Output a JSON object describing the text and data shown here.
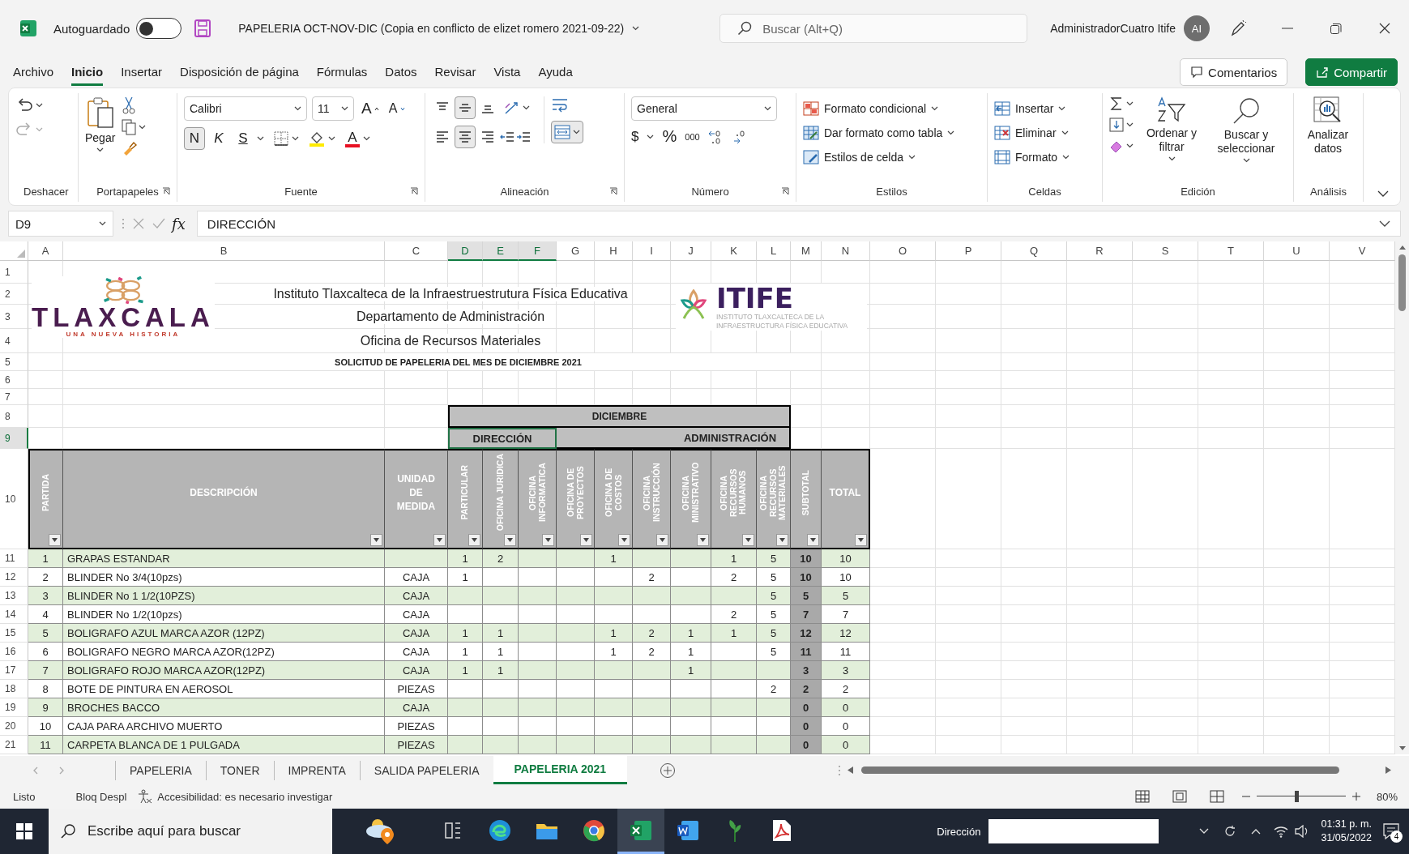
{
  "window": {
    "autosave_label": "Autoguardado",
    "autosave_on": false,
    "title": "PAPELERIA OCT-NOV-DIC (Copia en conflicto de elizet romero 2021-09-22)",
    "search_placeholder": "Buscar (Alt+Q)",
    "user_name": "AdministradorCuatro Itife",
    "user_initials": "AI"
  },
  "ribbon_tabs": [
    {
      "label": "Archivo",
      "selected": false
    },
    {
      "label": "Inicio",
      "selected": true
    },
    {
      "label": "Insertar",
      "selected": false
    },
    {
      "label": "Disposición de página",
      "selected": false
    },
    {
      "label": "Fórmulas",
      "selected": false
    },
    {
      "label": "Datos",
      "selected": false
    },
    {
      "label": "Revisar",
      "selected": false
    },
    {
      "label": "Vista",
      "selected": false
    },
    {
      "label": "Ayuda",
      "selected": false
    }
  ],
  "ribbon_actions": [
    {
      "label": "Comentarios",
      "kind": "comments"
    },
    {
      "label": "Compartir",
      "kind": "share"
    }
  ],
  "ribbon": {
    "undo": {
      "label": "Deshacer"
    },
    "clipboard": {
      "label": "Portapapeles",
      "paste": "Pegar"
    },
    "font": {
      "label": "Fuente",
      "family": "Calibri",
      "size": "11",
      "grow": "A",
      "shrink": "A",
      "bold": {
        "text": "N",
        "on": true
      },
      "italic": {
        "text": "K",
        "on": false
      },
      "underline": {
        "text": "S",
        "on": false
      },
      "color_letter": "A"
    },
    "alignment": {
      "label": "Alineación",
      "vertical": [
        {
          "kind": "top",
          "selected": false
        },
        {
          "kind": "middle",
          "selected": true
        },
        {
          "kind": "bottom",
          "selected": false
        }
      ],
      "horizontal": [
        {
          "kind": "left",
          "selected": false
        },
        {
          "kind": "center",
          "selected": true
        },
        {
          "kind": "right",
          "selected": false
        }
      ],
      "merged": true
    },
    "number": {
      "label": "Número",
      "format": "General",
      "currency": "$",
      "percent": "%",
      "thousands": "000"
    },
    "styles": {
      "label": "Estilos",
      "items": [
        "Formato condicional",
        "Dar formato como tabla",
        "Estilos de celda"
      ]
    },
    "cells": {
      "label": "Celdas",
      "items": [
        "Insertar",
        "Eliminar",
        "Formato"
      ]
    },
    "editing": {
      "label": "Edición",
      "sort": "Ordenar y filtrar",
      "find": "Buscar y seleccionar"
    },
    "analysis": {
      "label": "Análisis",
      "analyze": "Analizar datos"
    }
  },
  "formula_bar": {
    "cell": "D9",
    "fx": "fx",
    "content": "DIRECCIÓN"
  },
  "sheet": {
    "column_headers": [
      {
        "label": "A",
        "selected": false
      },
      {
        "label": "B",
        "selected": false
      },
      {
        "label": "C",
        "selected": false
      },
      {
        "label": "D",
        "selected": true
      },
      {
        "label": "E",
        "selected": true
      },
      {
        "label": "F",
        "selected": true
      },
      {
        "label": "G",
        "selected": false
      },
      {
        "label": "H",
        "selected": false
      },
      {
        "label": "I",
        "selected": false
      },
      {
        "label": "J",
        "selected": false
      },
      {
        "label": "K",
        "selected": false
      },
      {
        "label": "L",
        "selected": false
      },
      {
        "label": "M",
        "selected": false
      },
      {
        "label": "N",
        "selected": false
      },
      {
        "label": "O",
        "selected": false
      },
      {
        "label": "P",
        "selected": false
      },
      {
        "label": "Q",
        "selected": false
      },
      {
        "label": "R",
        "selected": false
      },
      {
        "label": "S",
        "selected": false
      },
      {
        "label": "T",
        "selected": false
      },
      {
        "label": "U",
        "selected": false
      },
      {
        "label": "V",
        "selected": false
      }
    ],
    "row_headers": [
      {
        "label": "1",
        "selected": false
      },
      {
        "label": "2",
        "selected": false
      },
      {
        "label": "3",
        "selected": false
      },
      {
        "label": "4",
        "selected": false
      },
      {
        "label": "5",
        "selected": false
      },
      {
        "label": "6",
        "selected": false
      },
      {
        "label": "7",
        "selected": false
      },
      {
        "label": "8",
        "selected": false
      },
      {
        "label": "9",
        "selected": true
      },
      {
        "label": "10",
        "selected": false
      },
      {
        "label": "11",
        "selected": false
      },
      {
        "label": "12",
        "selected": false
      },
      {
        "label": "13",
        "selected": false
      },
      {
        "label": "14",
        "selected": false
      },
      {
        "label": "15",
        "selected": false
      },
      {
        "label": "16",
        "selected": false
      },
      {
        "label": "17",
        "selected": false
      },
      {
        "label": "18",
        "selected": false
      },
      {
        "label": "19",
        "selected": false
      },
      {
        "label": "20",
        "selected": false
      },
      {
        "label": "21",
        "selected": false
      }
    ],
    "left_logo": {
      "wordmark": "TLAXCALA",
      "tagline": "UNA NUEVA HISTORIA"
    },
    "right_logo": {
      "wordmark": "ITIFE",
      "line_1": "INSTITUTO TLAXCALTECA DE LA",
      "line_2": "INFRAESTRUCTURA FÍSICA EDUCATIVA"
    },
    "titles": [
      "Instituto Tlaxcalteca de la Infraestruestrutura Física Educativa",
      "Departamento de Administración",
      "Oficina de Recursos Materiales"
    ],
    "subtitle": "SOLICITUD DE PAPELERIA DEL MES DE DICIEMBRE 2021",
    "period": "DICIEMBRE",
    "areas": [
      {
        "label": "DIRECCIÓN",
        "selected": true
      },
      {
        "label": "ADMINISTRACIÓN",
        "selected": false
      }
    ],
    "table": {
      "columns": [
        {
          "label": "PARTIDA",
          "kind": "vertical"
        },
        {
          "label": "DESCRIPCIÓN",
          "kind": "horizontal"
        },
        {
          "label": "UNIDAD DE MEDIDA",
          "kind": "horizontal"
        },
        {
          "label": "PARTICULAR",
          "kind": "vertical"
        },
        {
          "label": "OFICINA JURIDICA",
          "kind": "vertical"
        },
        {
          "label": "OFICINA INFORMATICA",
          "kind": "vertical"
        },
        {
          "label": "OFICINA DE PROYECTOS",
          "kind": "vertical"
        },
        {
          "label": "OFICINA DE COSTOS",
          "kind": "vertical"
        },
        {
          "label": "OFICINA INSTRUCCIÓN",
          "kind": "vertical"
        },
        {
          "label": "OFICINA MINISTRATIVO",
          "kind": "vertical"
        },
        {
          "label": "OFICINA RECURSOS HUMANOS",
          "kind": "vertical"
        },
        {
          "label": "OFICINA RECURSOS MATERIALES",
          "kind": "vertical"
        },
        {
          "label": "SUBTOTAL",
          "kind": "vertical"
        },
        {
          "label": "TOTAL",
          "kind": "horizontal"
        }
      ],
      "rows": [
        {
          "partida": "1",
          "description": "GRAPAS ESTANDAR",
          "quantities": {
            "D": "1",
            "E": "2",
            "H": "1",
            "K": "1",
            "L": "5"
          },
          "subtotal": "10",
          "total": "10"
        },
        {
          "partida": "2",
          "description": "BLINDER  No 3/4(10pzs)",
          "unit": "CAJA",
          "quantities": {
            "D": "1",
            "I": "2",
            "K": "2",
            "L": "5"
          },
          "subtotal": "10",
          "total": "10"
        },
        {
          "partida": "3",
          "description": "BLINDER No 1 1/2(10PZS)",
          "unit": "CAJA",
          "quantities": {
            "L": "5"
          },
          "subtotal": "5",
          "total": "5"
        },
        {
          "partida": "4",
          "description": "BLINDER No 1/2(10pzs)",
          "unit": "CAJA",
          "quantities": {
            "K": "2",
            "L": "5"
          },
          "subtotal": "7",
          "total": "7"
        },
        {
          "partida": "5",
          "description": "BOLIGRAFO AZUL MARCA AZOR (12PZ)",
          "unit": "CAJA",
          "quantities": {
            "D": "1",
            "E": "1",
            "H": "1",
            "I": "2",
            "J": "1",
            "K": "1",
            "L": "5"
          },
          "subtotal": "12",
          "total": "12"
        },
        {
          "partida": "6",
          "description": "BOLIGRAFO NEGRO MARCA AZOR(12PZ)",
          "unit": "CAJA",
          "quantities": {
            "D": "1",
            "E": "1",
            "H": "1",
            "I": "2",
            "J": "1",
            "L": "5"
          },
          "subtotal": "11",
          "total": "11"
        },
        {
          "partida": "7",
          "description": "BOLIGRAFO ROJO MARCA AZOR(12PZ)",
          "unit": "CAJA",
          "quantities": {
            "D": "1",
            "E": "1",
            "J": "1"
          },
          "subtotal": "3",
          "total": "3"
        },
        {
          "partida": "8",
          "description": "BOTE DE PINTURA EN AEROSOL",
          "unit": "PIEZAS",
          "quantities": {
            "L": "2"
          },
          "subtotal": "2",
          "total": "2"
        },
        {
          "partida": "9",
          "description": "BROCHES BACCO",
          "unit": "CAJA",
          "subtotal": "0",
          "total": "0"
        },
        {
          "partida": "10",
          "description": "CAJA PARA ARCHIVO MUERTO",
          "unit": "PIEZAS",
          "subtotal": "0",
          "total": "0"
        },
        {
          "partida": "11",
          "description": "CARPETA BLANCA DE 1 PULGADA",
          "unit": "PIEZAS",
          "subtotal": "0",
          "total": "0"
        }
      ]
    }
  },
  "sheet_tabs": [
    {
      "label": "PAPELERIA",
      "selected": false
    },
    {
      "label": "TONER",
      "selected": false
    },
    {
      "label": "IMPRENTA",
      "selected": false
    },
    {
      "label": "SALIDA PAPELERIA",
      "selected": false
    },
    {
      "label": "PAPELERIA 2021",
      "selected": true
    }
  ],
  "status_bar": {
    "ready": "Listo",
    "scroll_lock": "Bloq Despl",
    "accessibility": "Accesibilidad: es necesario investigar",
    "zoom": {
      "label": "80%",
      "level": 0.45
    }
  },
  "taskbar": {
    "search_placeholder": "Escribe aquí para buscar",
    "apps": [
      {
        "kind": "weather",
        "selected": false
      },
      {
        "kind": "taskview",
        "selected": false
      },
      {
        "kind": "browser",
        "selected": false
      },
      {
        "kind": "folder",
        "selected": false
      },
      {
        "kind": "globe",
        "selected": false
      },
      {
        "kind": "spreadsheet",
        "selected": true
      },
      {
        "kind": "document",
        "selected": false
      },
      {
        "kind": "plant",
        "selected": false
      },
      {
        "kind": "pdf",
        "selected": false
      }
    ],
    "address_label": "Dirección",
    "time": "01:31 p. m.",
    "date": "31/05/2022",
    "notifications": "4"
  }
}
